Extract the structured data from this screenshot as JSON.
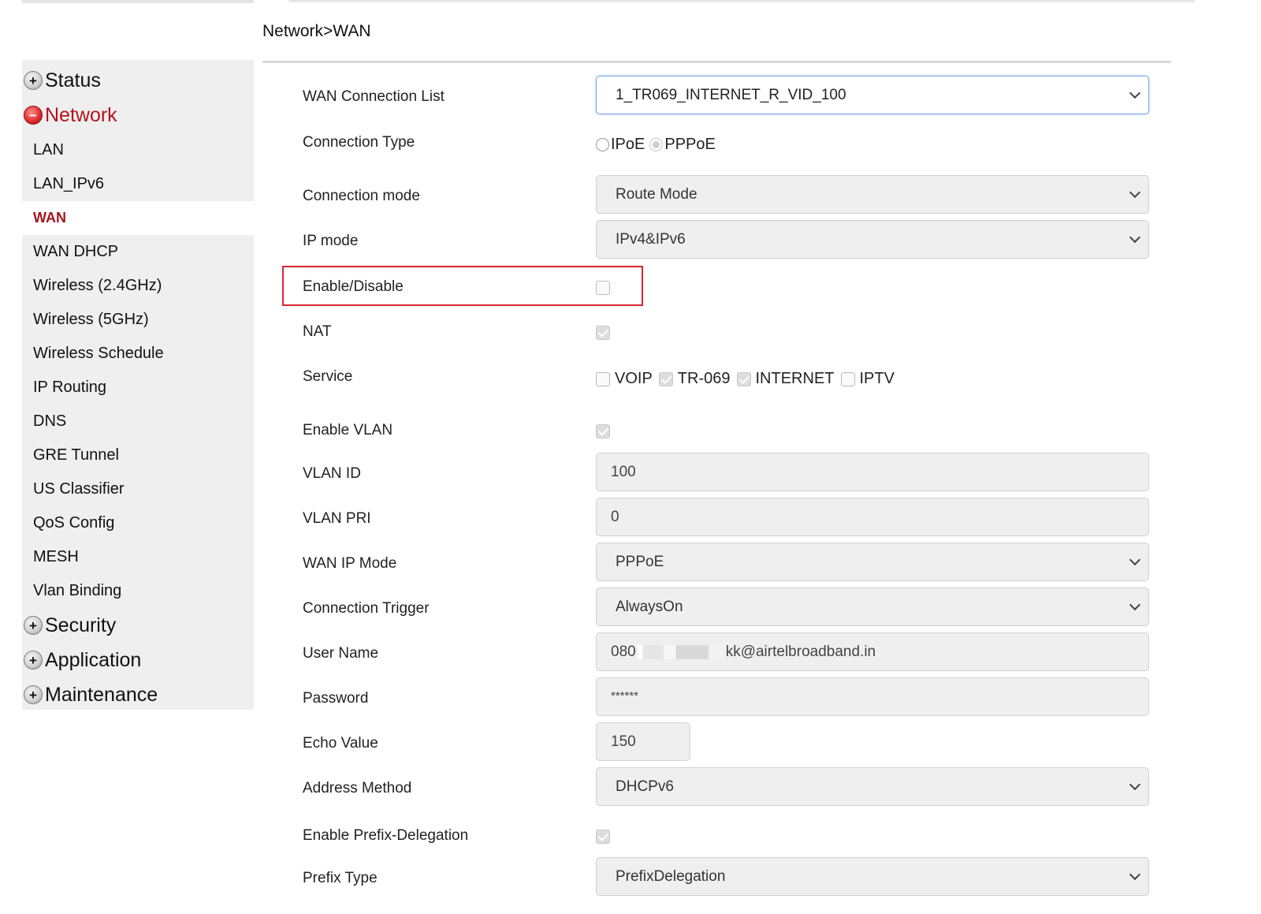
{
  "breadcrumb": "Network>WAN",
  "sidebar": {
    "groups": {
      "status": "Status",
      "network": "Network",
      "security": "Security",
      "application": "Application",
      "maintenance": "Maintenance"
    },
    "network_items": [
      "LAN",
      "LAN_IPv6",
      "WAN",
      "WAN DHCP",
      "Wireless (2.4GHz)",
      "Wireless (5GHz)",
      "Wireless Schedule",
      "IP Routing",
      "DNS",
      "GRE Tunnel",
      "US Classifier",
      "QoS Config",
      "MESH",
      "Vlan Binding"
    ],
    "active_item": "WAN"
  },
  "form": {
    "wan_connection_list": {
      "label": "WAN Connection List",
      "value": "1_TR069_INTERNET_R_VID_100"
    },
    "connection_type": {
      "label": "Connection Type",
      "options": [
        "IPoE",
        "PPPoE"
      ],
      "selected": "PPPoE"
    },
    "connection_mode": {
      "label": "Connection mode",
      "value": "Route Mode"
    },
    "ip_mode": {
      "label": "IP mode",
      "value": "IPv4&IPv6"
    },
    "enable_disable": {
      "label": "Enable/Disable",
      "checked": false
    },
    "nat": {
      "label": "NAT",
      "checked": true
    },
    "service": {
      "label": "Service",
      "options": [
        {
          "label": "VOIP",
          "checked": false
        },
        {
          "label": "TR-069",
          "checked": true
        },
        {
          "label": "INTERNET",
          "checked": true
        },
        {
          "label": "IPTV",
          "checked": false
        }
      ]
    },
    "enable_vlan": {
      "label": "Enable VLAN",
      "checked": true
    },
    "vlan_id": {
      "label": "VLAN ID",
      "value": "100"
    },
    "vlan_pri": {
      "label": "VLAN PRI",
      "value": "0"
    },
    "wan_ip_mode": {
      "label": "WAN IP Mode",
      "value": "PPPoE"
    },
    "connection_trigger": {
      "label": "Connection Trigger",
      "value": "AlwaysOn"
    },
    "user_name": {
      "label": "User Name",
      "value_prefix": "080",
      "value_suffix": "kk@airtelbroadband.in"
    },
    "password": {
      "label": "Password",
      "value": "******"
    },
    "echo_value": {
      "label": "Echo Value",
      "value": "150"
    },
    "address_method": {
      "label": "Address Method",
      "value": "DHCPv6"
    },
    "enable_prefix_delegation": {
      "label": "Enable Prefix-Delegation",
      "checked": true
    },
    "prefix_type": {
      "label": "Prefix Type",
      "value": "PrefixDelegation"
    }
  },
  "colors": {
    "accent_red": "#b5141c",
    "highlight_border": "#d7262f",
    "sidebar_bg": "#efefef"
  }
}
